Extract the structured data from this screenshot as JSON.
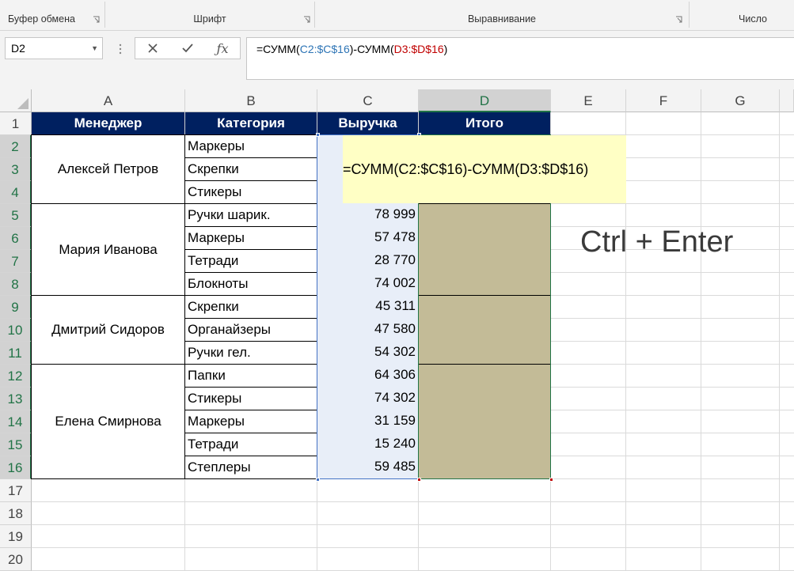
{
  "ribbon": {
    "groups": [
      {
        "label": "Буфер обмена"
      },
      {
        "label": "Шрифт"
      },
      {
        "label": "Выравнивание"
      },
      {
        "label": "Число"
      }
    ]
  },
  "formula_bar": {
    "name_box": "D2",
    "formula_parts": [
      {
        "text": "=СУММ(",
        "color": "#000000"
      },
      {
        "text": "C2:$C$16",
        "color": "#2e75b6"
      },
      {
        "text": ")-СУММ(",
        "color": "#000000"
      },
      {
        "text": "D3:$D$16",
        "color": "#c00000"
      },
      {
        "text": ")",
        "color": "#000000"
      }
    ]
  },
  "columns": [
    "A",
    "B",
    "C",
    "D",
    "E",
    "F",
    "G"
  ],
  "selected_column": "D",
  "rows": [
    "1",
    "2",
    "3",
    "4",
    "5",
    "6",
    "7",
    "8",
    "9",
    "10",
    "11",
    "12",
    "13",
    "14",
    "15",
    "16",
    "17",
    "18",
    "19",
    "20"
  ],
  "table": {
    "headers": [
      "Менеджер",
      "Категория",
      "Выручка",
      "Итого"
    ],
    "managers": [
      "Алексей Петров",
      "Мария Иванова",
      "Дмитрий Сидоров",
      "Елена Смирнова"
    ],
    "categories": [
      "Маркеры",
      "Скрепки",
      "Стикеры",
      "Ручки шарик.",
      "Маркеры",
      "Тетради",
      "Блокноты",
      "Скрепки",
      "Органайзеры",
      "Ручки гел.",
      "Папки",
      "Стикеры",
      "Маркеры",
      "Тетради",
      "Степлеры"
    ],
    "revenue": [
      "",
      "",
      "",
      "78 999",
      "57 478",
      "28 770",
      "74 002",
      "45 311",
      "47 580",
      "54 302",
      "64 306",
      "74 302",
      "31 159",
      "15 240",
      "59 485"
    ]
  },
  "tooltip": "=СУММ(C2:$C$16)-СУММ(D3:$D$16)",
  "shortcut": "Ctrl + Enter",
  "colors": {
    "header_fill": "#002060",
    "selection_fill": "#c3bb97",
    "revenue_fill": "#e8eef8",
    "tooltip_fill": "#ffffc5",
    "accent": "#217346"
  }
}
